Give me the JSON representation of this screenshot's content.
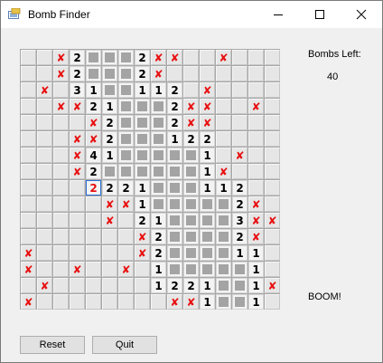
{
  "window": {
    "title": "Bomb Finder"
  },
  "status": {
    "bombs_left_label": "Bombs Left:",
    "bombs_left": "40",
    "message": "BOOM!"
  },
  "buttons": {
    "reset": "Reset",
    "quit": "Quit"
  },
  "icons": {
    "app": "app-icon",
    "minimize": "minimize-icon",
    "maximize": "maximize-icon",
    "close": "close-icon"
  },
  "colors": {
    "bomb_x": "#e81010",
    "selected_border": "#2b6fd6"
  },
  "board": {
    "rows": 16,
    "cols": 16,
    "selected": [
      8,
      4
    ],
    "cells": [
      [
        "",
        "",
        "X",
        "2",
        "B",
        "B",
        "B",
        "2",
        "X",
        "X",
        "",
        "",
        "X",
        "",
        "",
        ""
      ],
      [
        "",
        "",
        "X",
        "2",
        "B",
        "B",
        "B",
        "2",
        "X",
        "",
        "",
        "",
        "",
        "",
        "",
        ""
      ],
      [
        "",
        "X",
        "",
        "3",
        "1",
        "B",
        "B",
        "1",
        "1",
        "2",
        "",
        "X",
        "",
        "",
        "",
        ""
      ],
      [
        "",
        "",
        "X",
        "X",
        "2",
        "1",
        "B",
        "B",
        "B",
        "2",
        "X",
        "X",
        "",
        "",
        "X",
        ""
      ],
      [
        "",
        "",
        "",
        "",
        "X",
        "2",
        "B",
        "B",
        "B",
        "2",
        "X",
        "X",
        "",
        "",
        "",
        ""
      ],
      [
        "",
        "",
        "",
        "X",
        "X",
        "2",
        "B",
        "B",
        "B",
        "1",
        "2",
        "2",
        "",
        "",
        "",
        ""
      ],
      [
        "",
        "",
        "",
        "X",
        "4",
        "1",
        "B",
        "B",
        "B",
        "B",
        "B",
        "1",
        "",
        "X",
        "",
        ""
      ],
      [
        "",
        "",
        "",
        "X",
        "2",
        "B",
        "B",
        "B",
        "B",
        "B",
        "B",
        "1",
        "X",
        "",
        "",
        ""
      ],
      [
        "",
        "",
        "",
        "",
        "2",
        "2",
        "2",
        "1",
        "B",
        "B",
        "B",
        "1",
        "1",
        "2",
        "",
        ""
      ],
      [
        "",
        "",
        "",
        "",
        "",
        "X",
        "X",
        "1",
        "B",
        "B",
        "B",
        "B",
        "B",
        "2",
        "X",
        ""
      ],
      [
        "",
        "",
        "",
        "",
        "",
        "X",
        "",
        "2",
        "1",
        "B",
        "B",
        "B",
        "B",
        "3",
        "X",
        "X"
      ],
      [
        "",
        "",
        "",
        "",
        "",
        "",
        "",
        "X",
        "2",
        "B",
        "B",
        "B",
        "B",
        "2",
        "X",
        ""
      ],
      [
        "X",
        "",
        "",
        "",
        "",
        "",
        "",
        "X",
        "2",
        "B",
        "B",
        "B",
        "B",
        "1",
        "1",
        ""
      ],
      [
        "X",
        "",
        "",
        "X",
        "",
        "",
        "X",
        "",
        "1",
        "B",
        "B",
        "B",
        "B",
        "B",
        "1",
        ""
      ],
      [
        "",
        "X",
        "",
        "",
        "",
        "",
        "",
        "",
        "1",
        "2",
        "2",
        "1",
        "B",
        "B",
        "1",
        "X"
      ],
      [
        "X",
        "",
        "",
        "",
        "",
        "",
        "",
        "",
        "",
        "X",
        "X",
        "1",
        "B",
        "B",
        "1",
        ""
      ]
    ]
  }
}
